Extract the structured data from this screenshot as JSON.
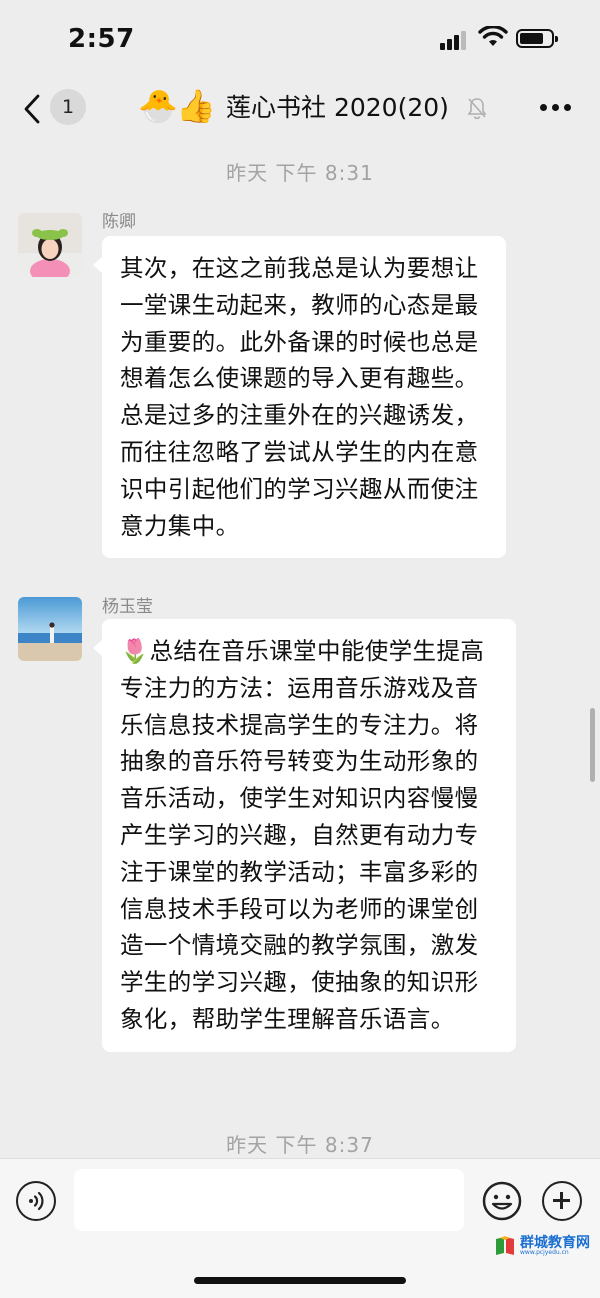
{
  "status_bar": {
    "time": "2:57"
  },
  "nav": {
    "unread_count": "1",
    "emoji_1": "🐣",
    "emoji_2": "👍",
    "title": "莲心书社 2020(20)"
  },
  "chat": {
    "timestamp_1": "昨天 下午 8:31",
    "messages": [
      {
        "sender": "陈卿",
        "text": "其次，在这之前我总是认为要想让一堂课生动起来，教师的心态是最为重要的。此外备课的时候也总是想着怎么使课题的导入更有趣些。总是过多的注重外在的兴趣诱发，而往往忽略了尝试从学生的内在意识中引起他们的学习兴趣从而使注意力集中。"
      },
      {
        "sender": "杨玉莹",
        "text": "🌷总结在音乐课堂中能使学生提高专注力的方法：运用音乐游戏及音乐信息技术提高学生的专注力。将抽象的音乐符号转变为生动形象的音乐活动，使学生对知识内容慢慢产生学习的兴趣，自然更有动力专注于课堂的教学活动；丰富多彩的信息技术手段可以为老师的课堂创造一个情境交融的教学氛围，激发学生的学习兴趣，使抽象的知识形象化，帮助学生理解音乐语言。"
      }
    ],
    "timestamp_2": "昨天 下午 8:37"
  },
  "watermark": {
    "text": "群城教育网",
    "url": "www.pcjyedu.cn"
  }
}
